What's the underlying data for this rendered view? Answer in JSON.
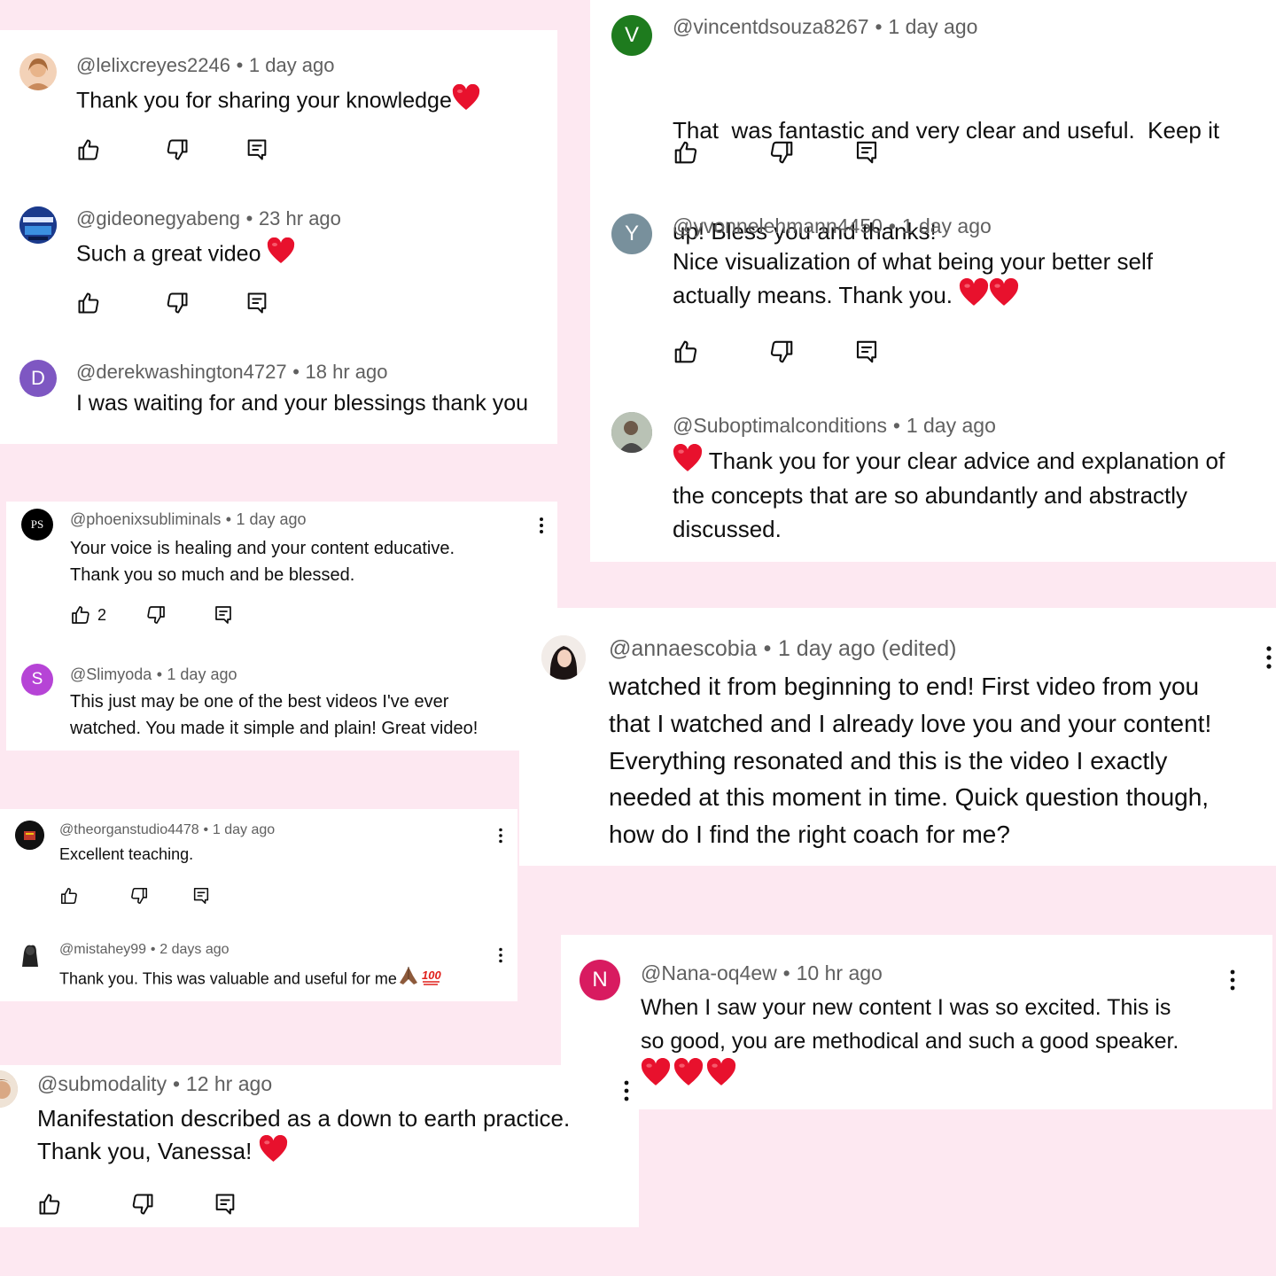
{
  "colors": {
    "background": "#fde8f1",
    "card": "#ffffff",
    "meta_text": "#606060",
    "heart": "#e8112d"
  },
  "icons": {
    "like": "thumbs-up-icon",
    "dislike": "thumbs-down-icon",
    "reply": "reply-icon",
    "more": "more-vertical-icon",
    "heart": "red-heart-emoji",
    "pray": "folded-hands-emoji",
    "hundred": "hundred-points-emoji"
  },
  "comments": [
    {
      "handle": "@lelixcreyes2246",
      "time": "1 day ago",
      "text": "Thank you for sharing your knowledge",
      "avatar_color": "#e8b48a"
    },
    {
      "handle": "@gideonegyabeng",
      "time": "23 hr ago",
      "text": "Such a great video",
      "avatar_color": "#1b3a8c"
    },
    {
      "handle": "@derekwashington4727",
      "time": "18 hr ago",
      "text": "I was waiting for and your blessings thank you",
      "avatar_letter": "D",
      "avatar_color": "#7e57c2"
    },
    {
      "handle": "@phoenixsubliminals",
      "time": "1 day ago",
      "text_line1": "Your voice is healing and your content educative.",
      "text_line2": "Thank you so much and be blessed.",
      "likes": "2",
      "avatar_letter": "PS",
      "avatar_color": "#000000"
    },
    {
      "handle": "@Slimyoda",
      "time": "1 day ago",
      "text_line1": "This just may be one of the best videos I've ever",
      "text_line2": "watched. You made it simple and plain! Great video!",
      "avatar_letter": "S",
      "avatar_color": "#b644d6"
    },
    {
      "handle": "@theorganstudio4478",
      "time": "1 day ago",
      "text": "Excellent teaching.",
      "avatar_color": "#111111"
    },
    {
      "handle": "@mistahey99",
      "time": "2 days ago",
      "text": "Thank you. This was valuable and useful for me",
      "avatar_color": "#222222"
    },
    {
      "handle": "@submodality",
      "time": "12 hr ago",
      "text_line1": "Manifestation described as a down to earth practice.",
      "text_line2": "Thank you, Vanessa!",
      "avatar_color": "#d9b8a0"
    },
    {
      "handle": "@vincentdsouza8267",
      "time": "1 day ago",
      "text_line1": "That  was fantastic and very clear and useful.  Keep it",
      "text_line2": "up! Bless you and thanks!",
      "avatar_letter": "V",
      "avatar_color": "#1e7b1e"
    },
    {
      "handle": "@yvonnelehmann4450",
      "time": "1 day ago",
      "text_line1": "Nice visualization of what being your better self",
      "text_line2": "actually means. Thank you.",
      "avatar_letter": "Y",
      "avatar_color": "#78909c"
    },
    {
      "handle": "@Suboptimalconditions",
      "time": "1 day ago",
      "text_line1": "Thank you for your clear advice and explanation of",
      "text_line2": "the concepts that are so abundantly and abstractly",
      "text_line3": "discussed.",
      "avatar_color": "#7d8a7a"
    },
    {
      "handle": "@annaescobia",
      "time": "1 day ago (edited)",
      "text_line1": "watched it from beginning to end! First video from you",
      "text_line2": "that I watched and I already love you and your content!",
      "text_line3": "Everything resonated and this is the video I exactly",
      "text_line4": "needed at this moment in time. Quick question though,",
      "text_line5": "how do I find the right coach for me?",
      "avatar_color": "#3a2e2e"
    },
    {
      "handle": "@Nana-oq4ew",
      "time": "10 hr ago",
      "text_line1": "When I saw your new content I was so excited. This is",
      "text_line2": "so good, you are methodical and such a good speaker.",
      "avatar_letter": "N",
      "avatar_color": "#d81b60"
    }
  ]
}
